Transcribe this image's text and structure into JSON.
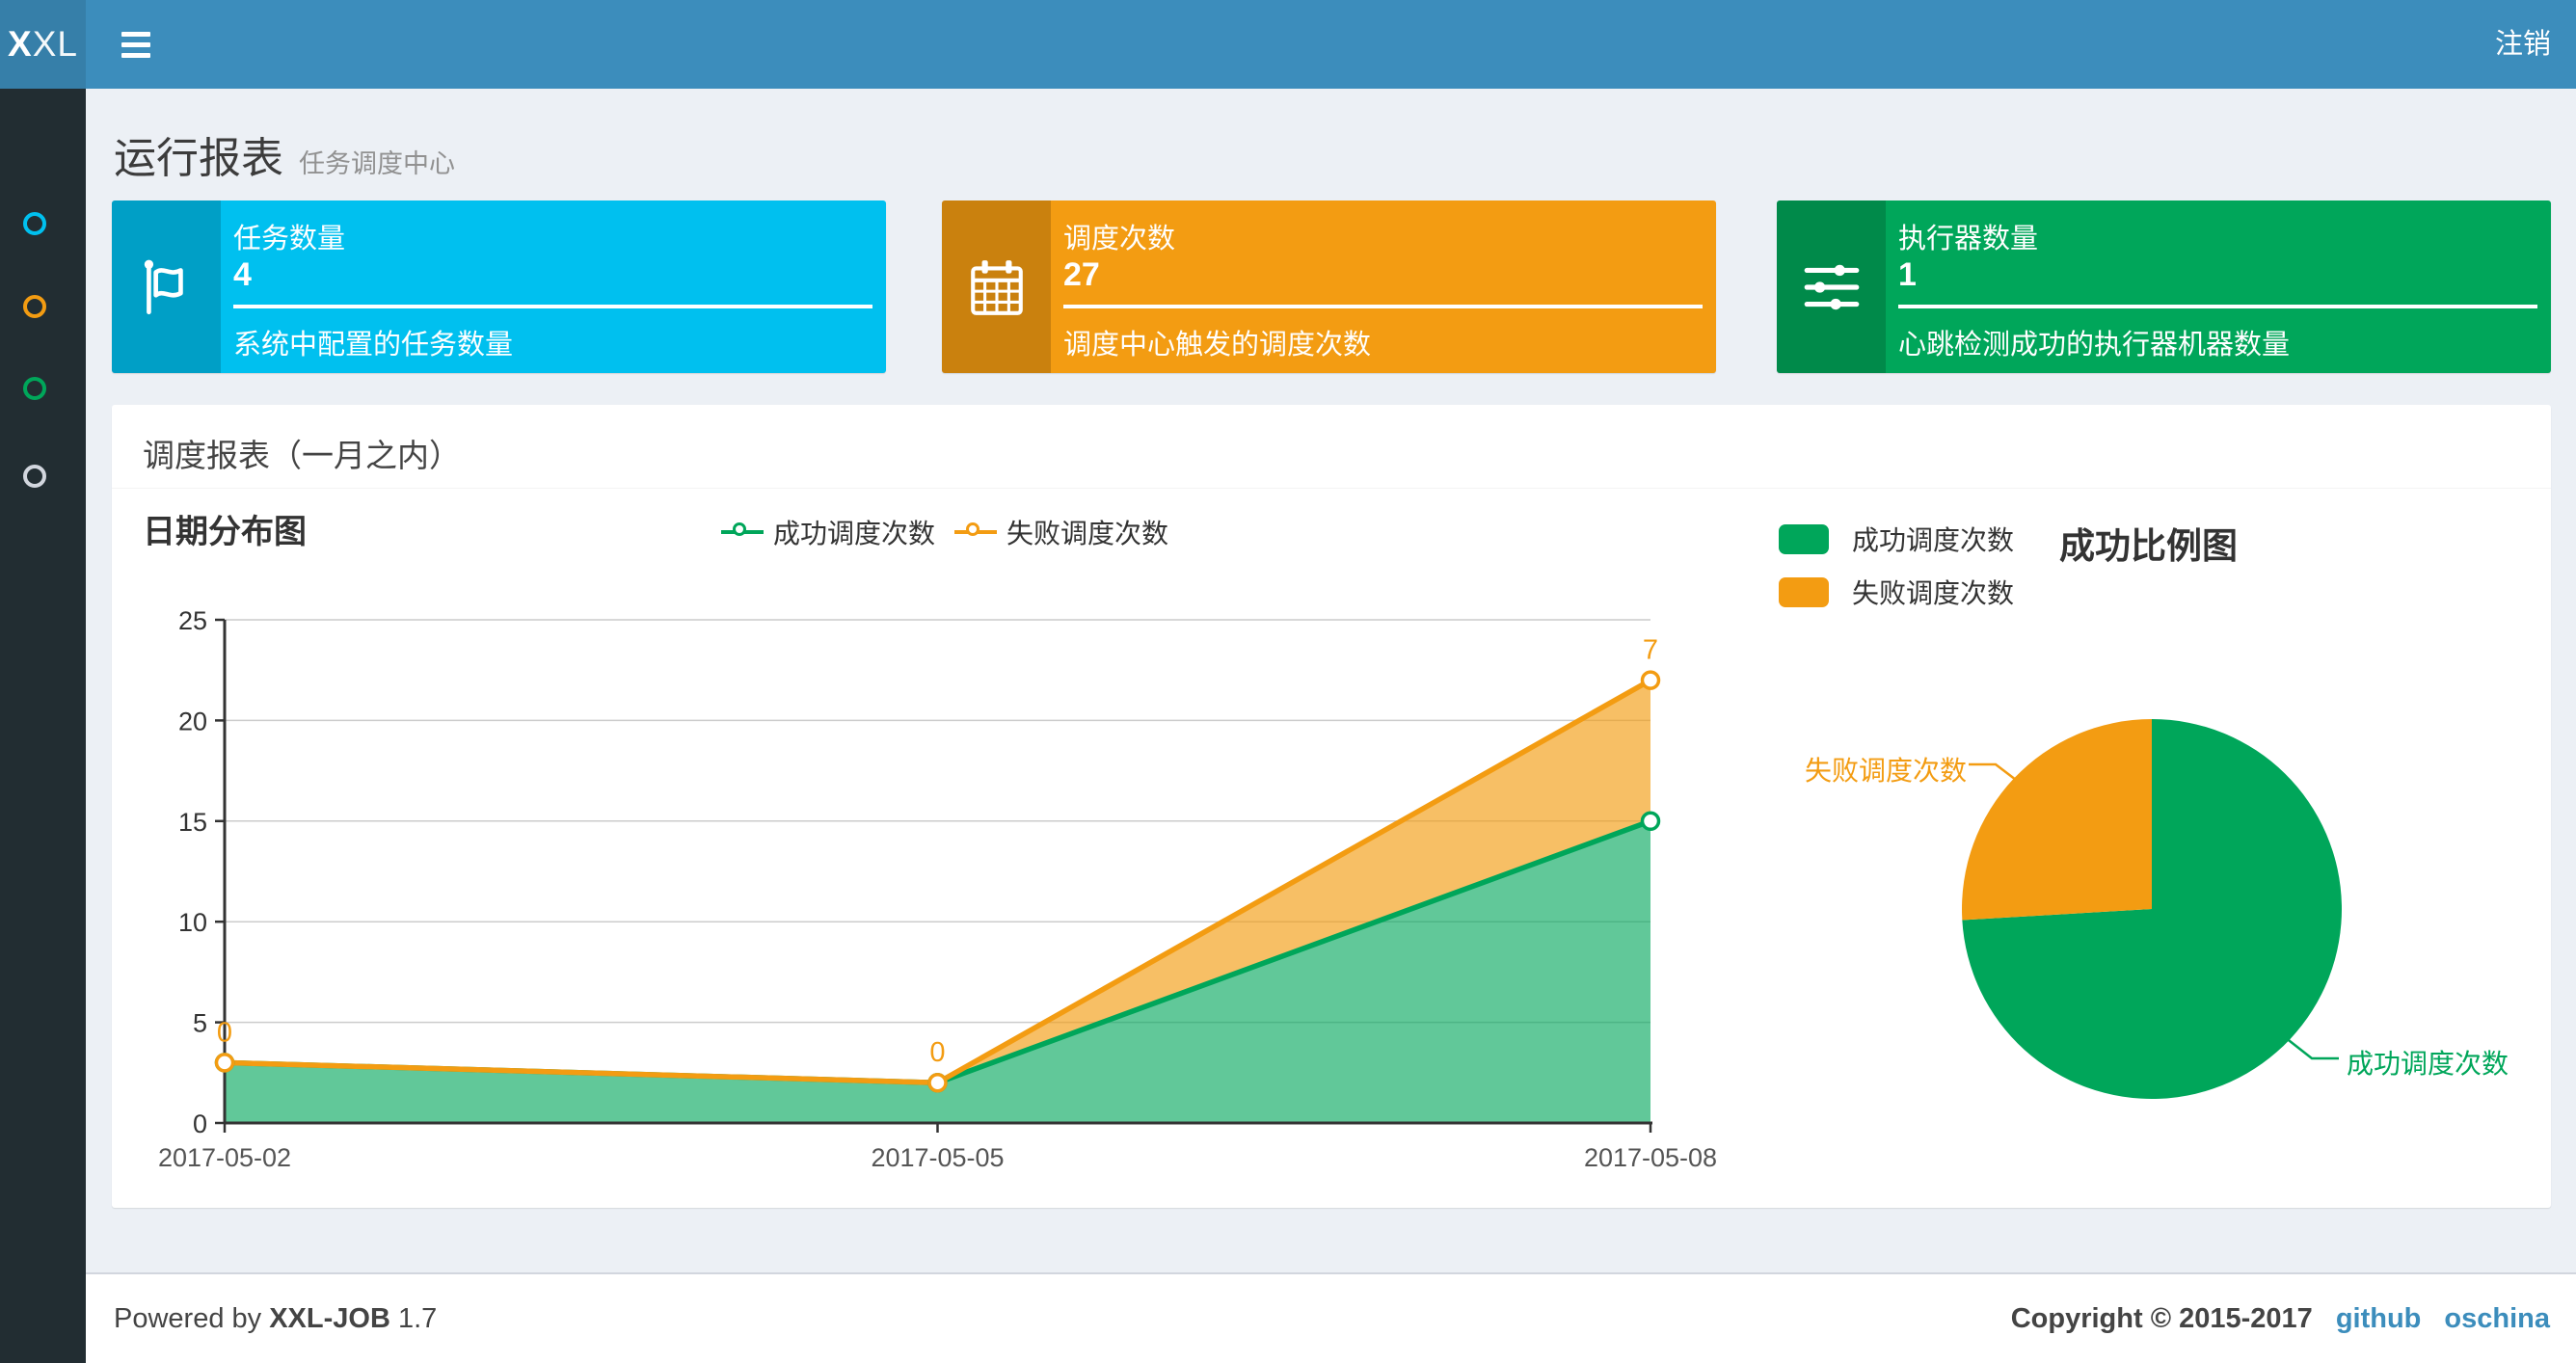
{
  "colors": {
    "navbar": "#3c8dbc",
    "logo_bg": "#367fa9",
    "sidebar": "#222d32",
    "aqua": "#00c0ef",
    "yellow": "#f39c12",
    "green": "#00a65a",
    "link_blue": "#3c8dbc",
    "muted_circle": "#d2d6de"
  },
  "navbar": {
    "logo": "XXL",
    "logo_bold": "X",
    "logo_rest": "XL",
    "logout_label": "注销",
    "hamburger": "menu-icon"
  },
  "sidebar": {
    "items": [
      {
        "icon": "circle-icon",
        "color": "#00c0ef"
      },
      {
        "icon": "circle-icon",
        "color": "#f39c12"
      },
      {
        "icon": "circle-icon",
        "color": "#00a65a"
      },
      {
        "icon": "circle-icon",
        "color": "#d2d6de"
      }
    ]
  },
  "page_header": {
    "title": "运行报表",
    "subtitle": "任务调度中心"
  },
  "info_boxes": [
    {
      "label": "任务数量",
      "value": "4",
      "description": "系统中配置的任务数量",
      "color": "#00c0ef",
      "icon": "flag-icon"
    },
    {
      "label": "调度次数",
      "value": "27",
      "description": "调度中心触发的调度次数",
      "color": "#f39c12",
      "icon": "calendar-icon"
    },
    {
      "label": "执行器数量",
      "value": "1",
      "description": "心跳检测成功的执行器机器数量",
      "color": "#00a65a",
      "icon": "sliders-icon"
    }
  ],
  "panel": {
    "title": "调度报表（一月之内）"
  },
  "chart_data": [
    {
      "type": "area",
      "title": "日期分布图",
      "categories": [
        "2017-05-02",
        "2017-05-05",
        "2017-05-08"
      ],
      "series": [
        {
          "name": "成功调度次数",
          "values": [
            3,
            2,
            15
          ],
          "color": "#00a65a"
        },
        {
          "name": "失败调度次数",
          "values": [
            0,
            0,
            7
          ],
          "color": "#f39c12"
        }
      ],
      "stacked": true,
      "labeled_series_index": 1,
      "ylim": [
        0,
        25
      ],
      "yticks": [
        0,
        5,
        10,
        15,
        20,
        25
      ],
      "grid": true,
      "legend_position": "top-center"
    },
    {
      "type": "pie",
      "title": "成功比例图",
      "slices": [
        {
          "name": "成功调度次数",
          "value": 20,
          "color": "#00a65a"
        },
        {
          "name": "失败调度次数",
          "value": 7,
          "color": "#f39c12"
        }
      ],
      "legend_position": "top-left"
    }
  ],
  "footer": {
    "powered_by": "Powered by",
    "product": "XXL-JOB",
    "version": "1.7",
    "copyright": "Copyright © 2015-2017",
    "links": [
      {
        "label": "github"
      },
      {
        "label": "oschina"
      }
    ]
  }
}
